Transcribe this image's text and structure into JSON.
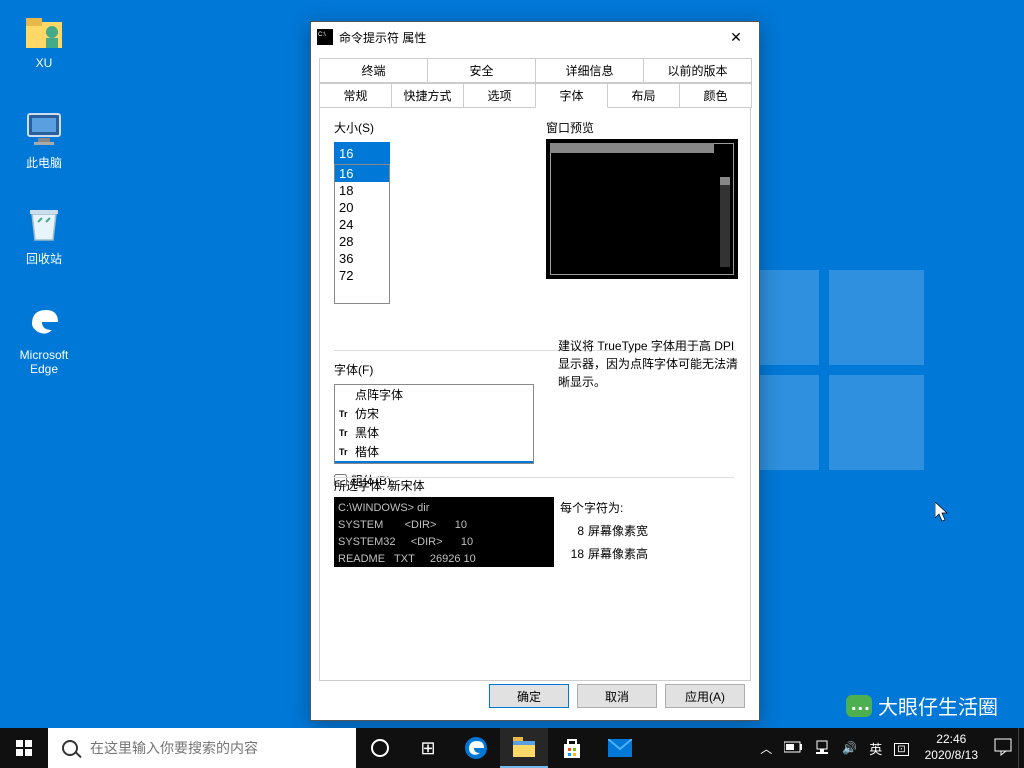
{
  "desktop": {
    "icons": [
      {
        "label": "XU"
      },
      {
        "label": "此电脑"
      },
      {
        "label": "回收站"
      },
      {
        "label": "Microsoft Edge"
      }
    ]
  },
  "dialog": {
    "title": "命令提示符 属性",
    "tabs_row1": [
      "终端",
      "安全",
      "详细信息",
      "以前的版本"
    ],
    "tabs_row2": [
      "常规",
      "快捷方式",
      "选项",
      "字体",
      "布局",
      "颜色"
    ],
    "active_tab": "字体",
    "size_label": "大小(S)",
    "size_value": "16",
    "sizes": [
      "16",
      "18",
      "20",
      "24",
      "28",
      "36",
      "72"
    ],
    "size_selected": "16",
    "preview_label": "窗口预览",
    "font_label": "字体(F)",
    "fonts": [
      {
        "name": "点阵字体",
        "tt": false
      },
      {
        "name": "仿宋",
        "tt": true
      },
      {
        "name": "黑体",
        "tt": true
      },
      {
        "name": "楷体",
        "tt": true
      },
      {
        "name": "新宋体",
        "tt": true
      }
    ],
    "font_selected": "新宋体",
    "font_hint": "建议将 TrueType 字体用于高 DPI 显示器，因为点阵字体可能无法清晰显示。",
    "bold_label": "粗体(B)",
    "selected_font_label": "所选字体: 新宋体",
    "sample_lines": [
      "C:\\WINDOWS> dir",
      "SYSTEM       <DIR>      10",
      "SYSTEM32     <DIR>      10",
      "README   TXT     26926 10"
    ],
    "char_label": "每个字符为:",
    "char_w_num": "8",
    "char_w": "屏幕像素宽",
    "char_h_num": "18",
    "char_h": "屏幕像素高",
    "buttons": {
      "ok": "确定",
      "cancel": "取消",
      "apply": "应用(A)"
    }
  },
  "taskbar": {
    "search_placeholder": "在这里输入你要搜索的内容",
    "ime": "英",
    "time": "22:46",
    "date": "2020/8/13"
  },
  "watermark": "大眼仔生活圈"
}
